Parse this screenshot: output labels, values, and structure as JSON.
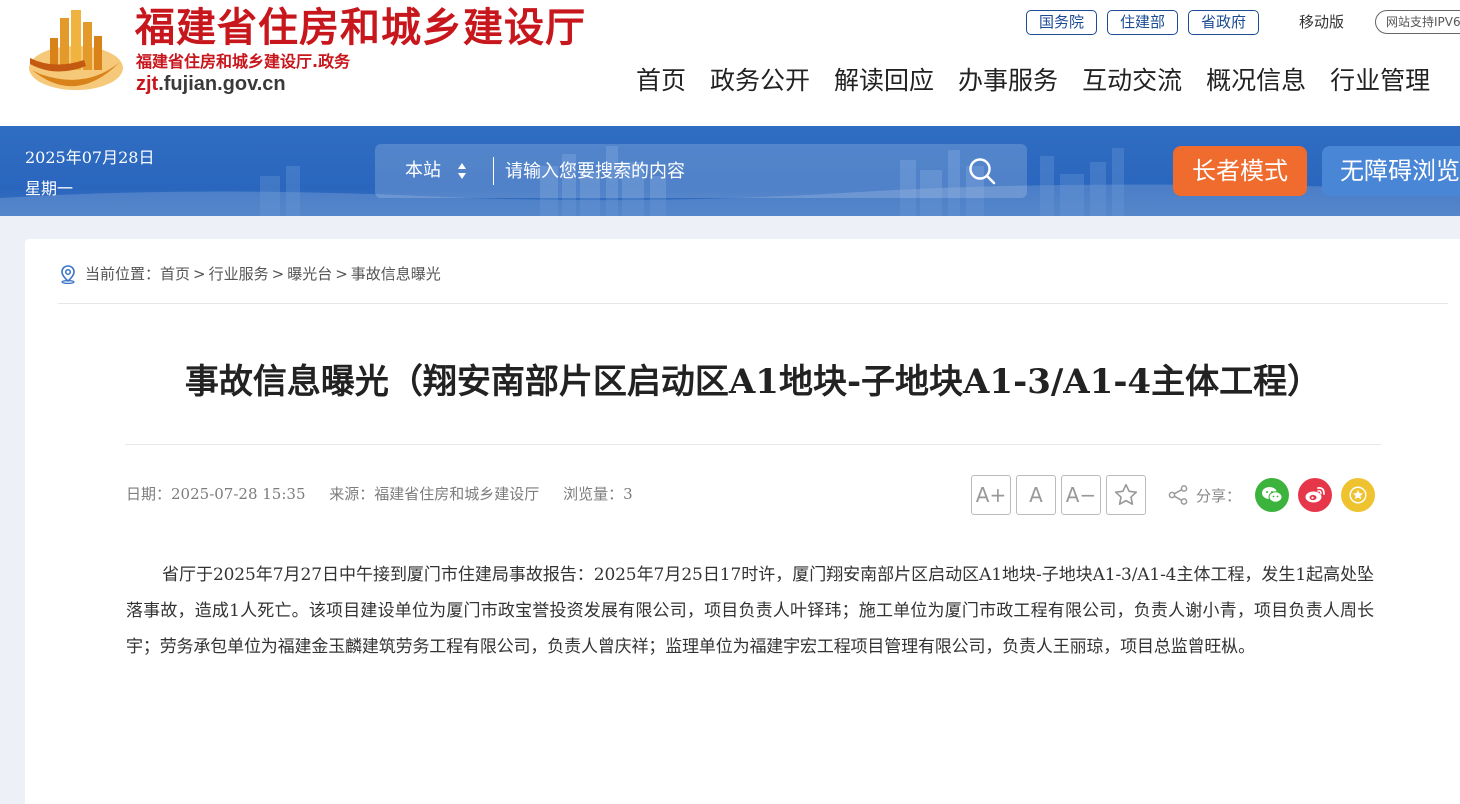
{
  "header": {
    "site_title": "福建省住房和城乡建设厅",
    "site_subtitle": "福建省住房和城乡建设厅.政务",
    "url_prefix": "zjt",
    "url_suffix": ".fujian.gov.cn",
    "top_links": [
      "国务院",
      "住建部",
      "省政府"
    ],
    "mobile_label": "移动版",
    "ipv6_label": "网站支持IPV6",
    "nav": [
      "首页",
      "政务公开",
      "解读回应",
      "办事服务",
      "互动交流",
      "概况信息",
      "行业管理"
    ]
  },
  "banner": {
    "date": "2025年07月28日",
    "weekday": "星期一",
    "search_scope": "本站",
    "search_placeholder": "请输入您要搜索的内容",
    "elder_mode": "长者模式",
    "accessible_browse": "无障碍浏览"
  },
  "breadcrumb": {
    "label": "当前位置：",
    "items": [
      "首页",
      "行业服务",
      "曝光台",
      "事故信息曝光"
    ],
    "separator": ">"
  },
  "article": {
    "title": "事故信息曝光（翔安南部片区启动区A1地块-子地块A1-3/A1-4主体工程）",
    "date_label": "日期：",
    "date": "2025-07-28 15:35",
    "source_label": "来源：",
    "source": "福建省住房和城乡建设厅",
    "views_label": "浏览量：",
    "views": "3",
    "font_plus": "A+",
    "font_normal": "A",
    "font_minus": "A−",
    "share_label": "分享：",
    "body": "省厅于2025年7月27日中午接到厦门市住建局事故报告：2025年7月25日17时许，厦门翔安南部片区启动区A1地块-子地块A1-3/A1-4主体工程，发生1起高处坠落事故，造成1人死亡。该项目建设单位为厦门市政宝誉投资发展有限公司，项目负责人叶铎玮；施工单位为厦门市政工程有限公司，负责人谢小青，项目负责人周长宇；劳务承包单位为福建金玉麟建筑劳务工程有限公司，负责人曾庆祥；监理单位为福建宇宏工程项目管理有限公司，负责人王丽琼，项目总监曾旺枞。"
  },
  "colors": {
    "brand_red": "#c8161d",
    "banner_blue": "#2a66bd",
    "elder_orange": "#ef6b2e",
    "wechat_green": "#3bb33d",
    "weibo_red": "#e6364a",
    "favor_yellow": "#efc32f"
  }
}
